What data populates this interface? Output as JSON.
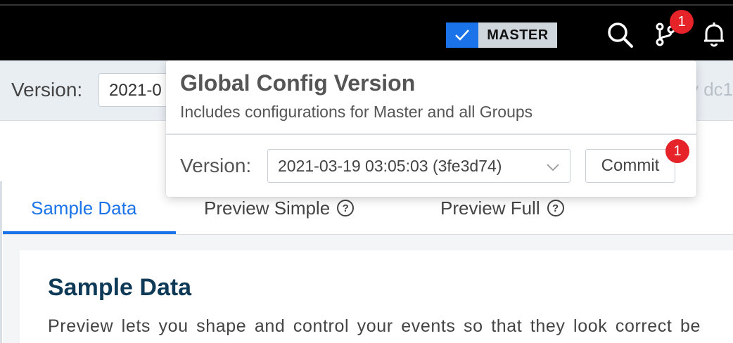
{
  "topbar": {
    "branch_badge": "MASTER",
    "git_changes_count": "1"
  },
  "version_row": {
    "label": "Version:",
    "value": "2021-0",
    "right_text": "y dc1"
  },
  "popover": {
    "title": "Global Config Version",
    "subtitle": "Includes configurations for Master and all Groups",
    "version_label": "Version:",
    "version_value": "2021-03-19 03:05:03 (3fe3d74)",
    "commit_label": "Commit",
    "commit_count": "1"
  },
  "tabs": [
    {
      "label": "Sample Data",
      "active": true
    },
    {
      "label": "Preview Simple",
      "help": "?"
    },
    {
      "label": "Preview Full",
      "help": "?"
    }
  ],
  "content": {
    "title": "Sample Data",
    "description": "Preview lets you shape and control your events so that they look correct be"
  },
  "colors": {
    "accent": "#1a73e8",
    "badge": "#e52328",
    "heading": "#0e3a57"
  }
}
